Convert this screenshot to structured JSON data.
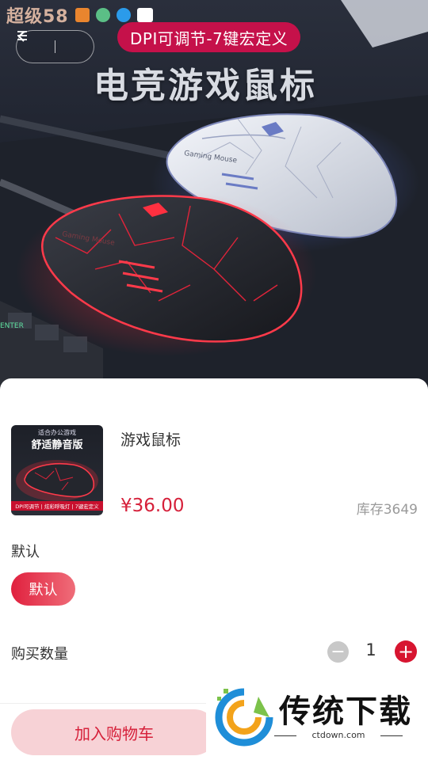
{
  "status_bar": {
    "app_logo_text": "超级58",
    "icons": [
      "app-icon-orange",
      "leaf-icon",
      "download-icon",
      "card-icon"
    ]
  },
  "nav": {
    "back_icon": "chevron-left-icon",
    "menu_icon": "menu-icon"
  },
  "hero": {
    "banner_pill": "DPI可调节-7键宏定义",
    "banner_title": "电竞游戏鼠标",
    "mouse_label": "Gaming Mouse"
  },
  "product": {
    "name": "游戏鼠标",
    "price": "¥36.00",
    "stock": "库存3649",
    "thumb": {
      "top_text": "适合办公游戏",
      "headline": "舒适静音版",
      "footer": "DPI可调节 | 炫彩呼吸灯 | 7键宏定义"
    }
  },
  "spec": {
    "title": "默认",
    "options": [
      {
        "label": "默认",
        "selected": true
      }
    ]
  },
  "quantity": {
    "label": "购买数量",
    "value": "1",
    "minus_symbol": "−",
    "plus_symbol": "+"
  },
  "actions": {
    "add_to_cart": "加入购物车"
  },
  "watermark": {
    "title": "传统下载",
    "subtitle": "ctdown.com"
  },
  "colors": {
    "accent": "#d6203a",
    "cart_button_bg": "#f7d2d6",
    "banner_pill": "#c5114a"
  }
}
